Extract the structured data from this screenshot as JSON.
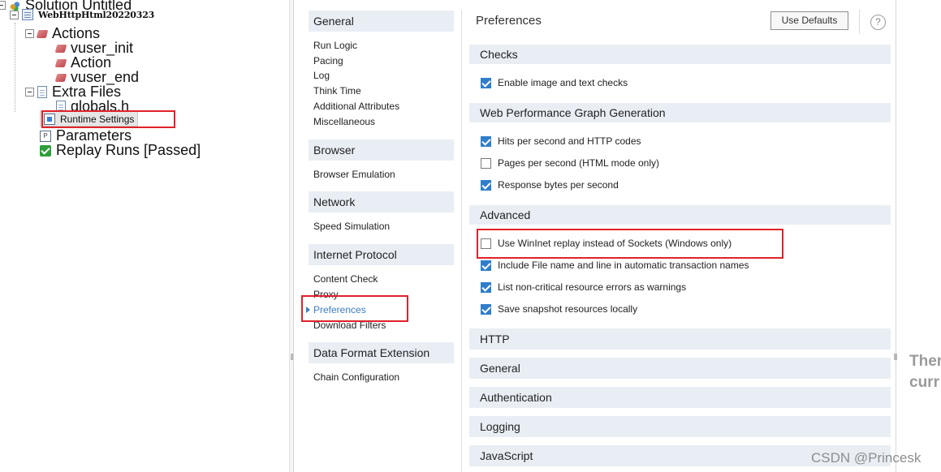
{
  "tree": {
    "solution": "Solution Untitled",
    "script": "WebHttpHtml20220323",
    "actions": "Actions",
    "vuser_init": "vuser_init",
    "action": "Action",
    "vuser_end": "vuser_end",
    "extra_files": "Extra Files",
    "globals": "globals.h",
    "runtime_settings": "Runtime Settings",
    "parameters": "Parameters",
    "replay_runs": "Replay Runs [Passed]"
  },
  "nav": {
    "groups": {
      "general": "General",
      "browser": "Browser",
      "network": "Network",
      "internet_protocol": "Internet Protocol",
      "data_format": "Data Format Extension"
    },
    "items": {
      "run_logic": "Run Logic",
      "pacing": "Pacing",
      "log": "Log",
      "think_time": "Think Time",
      "additional_attributes": "Additional Attributes",
      "miscellaneous": "Miscellaneous",
      "browser_emulation": "Browser Emulation",
      "speed_simulation": "Speed Simulation",
      "content_check": "Content Check",
      "proxy": "Proxy",
      "preferences": "Preferences",
      "download_filters": "Download Filters",
      "chain_configuration": "Chain Configuration"
    }
  },
  "content": {
    "title": "Preferences",
    "use_defaults": "Use Defaults",
    "help": "?",
    "sections": {
      "checks": "Checks",
      "web_perf": "Web Performance Graph Generation",
      "advanced": "Advanced",
      "http": "HTTP",
      "general": "General",
      "authentication": "Authentication",
      "logging": "Logging",
      "javascript": "JavaScript"
    },
    "options": {
      "image_text_checks": {
        "label": "Enable image and text checks",
        "checked": true
      },
      "hits_per_second": {
        "label": "Hits per second and HTTP codes",
        "checked": true
      },
      "pages_per_second": {
        "label": "Pages per second (HTML mode only)",
        "checked": false
      },
      "response_bytes": {
        "label": "Response bytes per second",
        "checked": true
      },
      "wininet_replay": {
        "label": "Use WinInet replay instead of Sockets (Windows only)",
        "checked": false
      },
      "include_file_name": {
        "label": "Include File name and line in automatic transaction names",
        "checked": true
      },
      "non_critical_errors": {
        "label": "List non-critical resource errors as warnings",
        "checked": true
      },
      "save_snapshot": {
        "label": "Save snapshot resources locally",
        "checked": true
      }
    }
  },
  "cutoff": {
    "line1": "Ther",
    "line2": "curr"
  },
  "watermark": "CSDN @Princesk",
  "colors": {
    "accent": "#2f7ecb",
    "highlight_box": "#e0222a",
    "section_bg": "#e9eef5"
  }
}
